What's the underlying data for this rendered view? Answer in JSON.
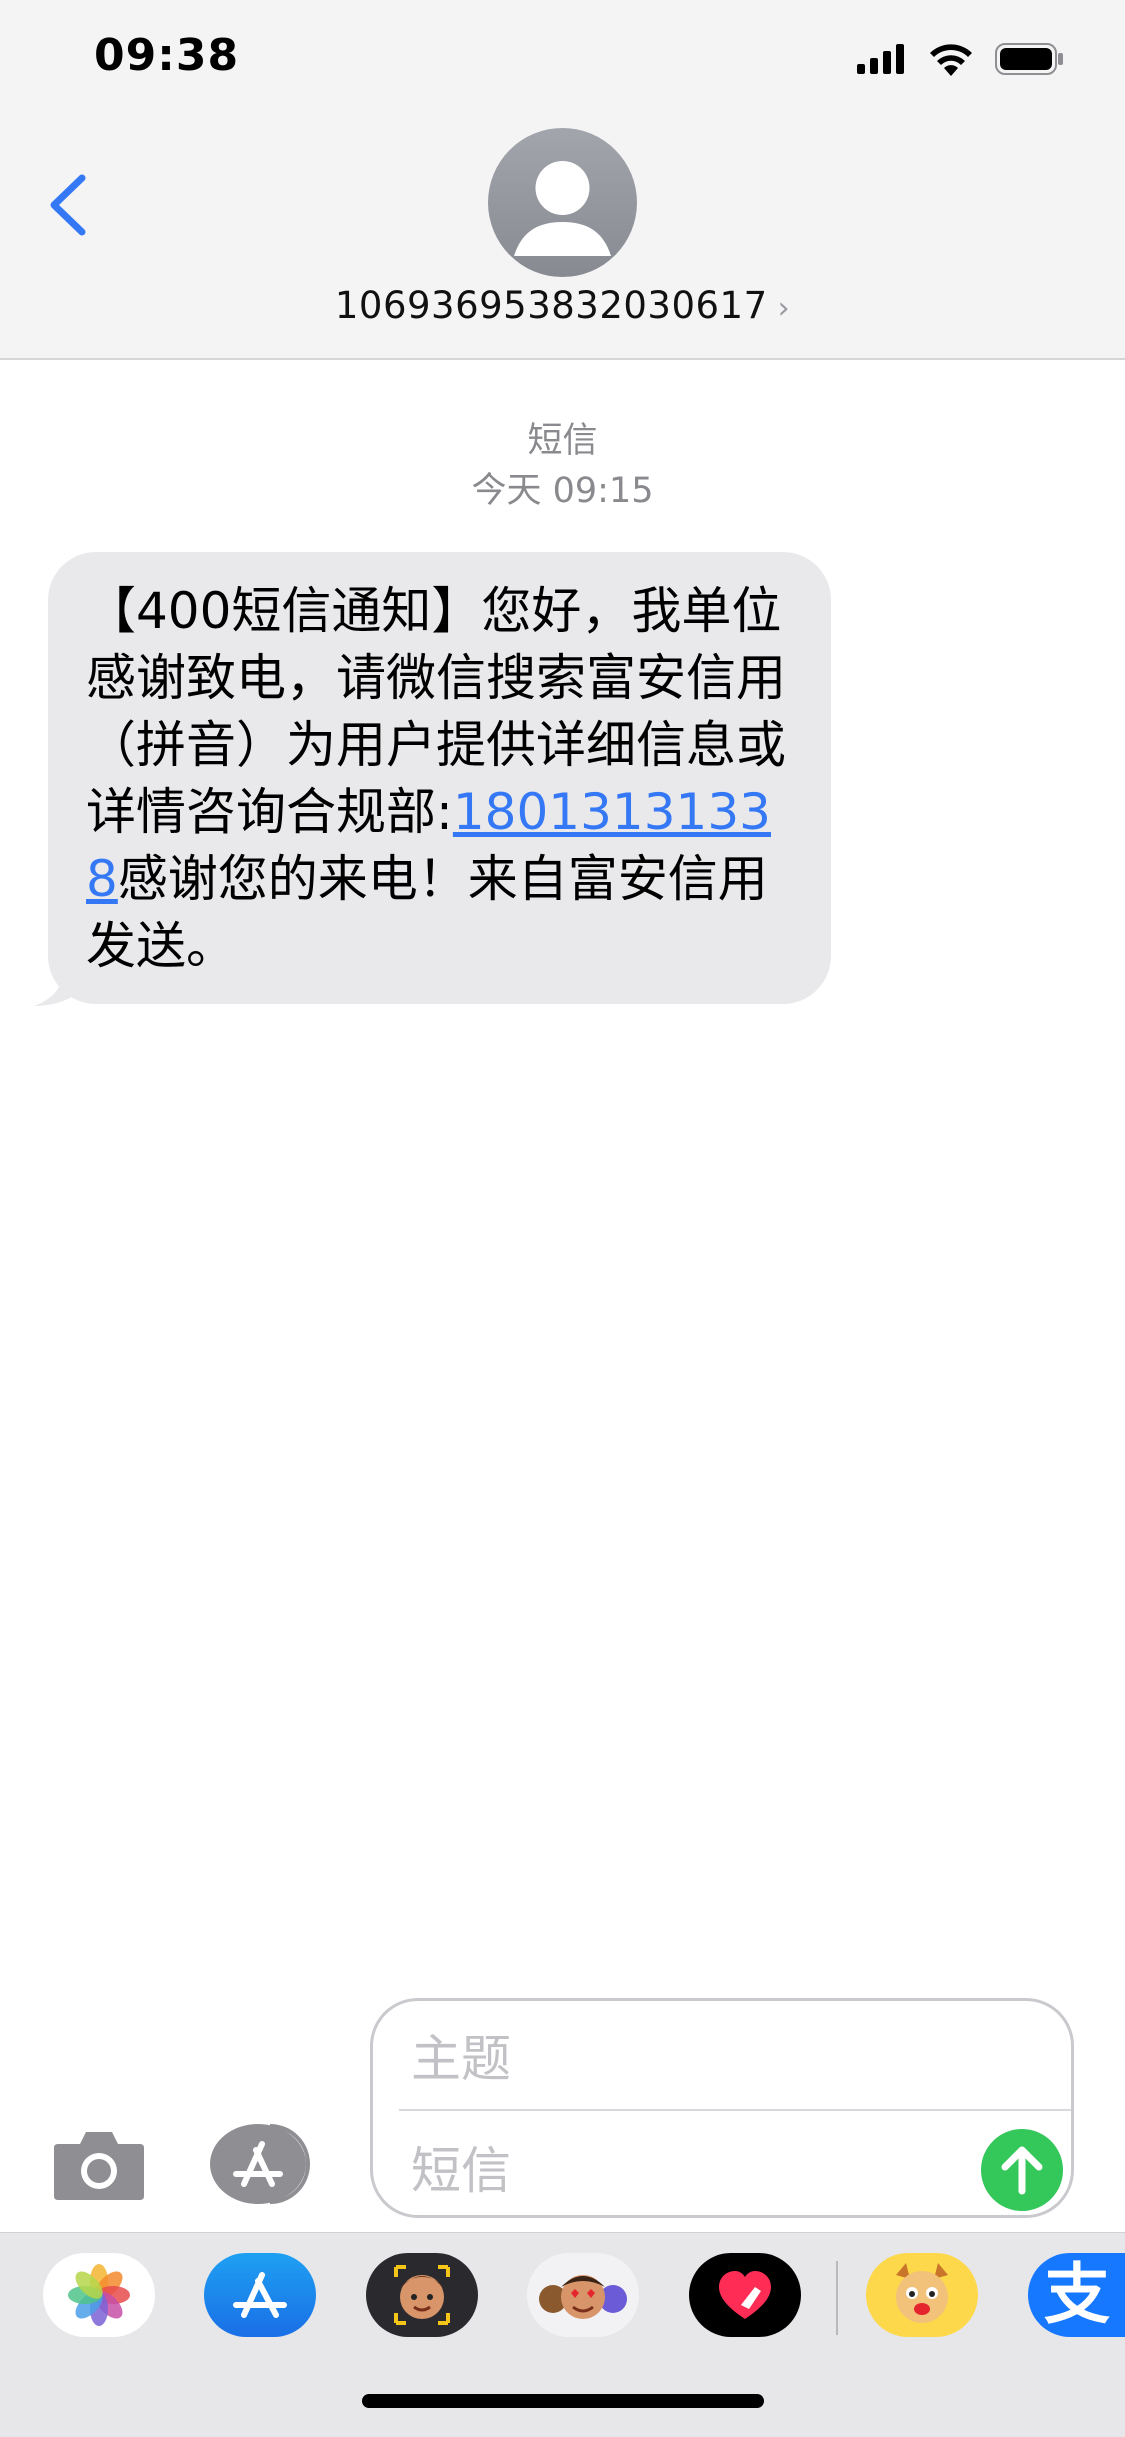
{
  "status_bar": {
    "time": "09:38"
  },
  "header": {
    "contact": "106936953832030617",
    "chevron": "›"
  },
  "conversation": {
    "service": "短信",
    "timestamp": "今天 09:15",
    "message": {
      "before_link": "【400短信通知】您好，我单位感谢致电，请微信搜索富安信用（拼音）为用户提供详细信息或详情咨询合规部:",
      "link": "18013131338",
      "after_link": "感谢您的来电！来自富安信用发送。"
    }
  },
  "compose": {
    "subject_placeholder": "主题",
    "message_placeholder": "短信"
  },
  "app_strip": {
    "apps": [
      "photos-icon",
      "app-store-icon",
      "memoji-icon",
      "animoji-icon",
      "digital-touch-icon",
      "sticker-icon",
      "alipay-icon"
    ],
    "alipay_glyph": "支"
  },
  "colors": {
    "link": "#3478f6",
    "send": "#34c759",
    "bubble": "#e9e9eb"
  }
}
